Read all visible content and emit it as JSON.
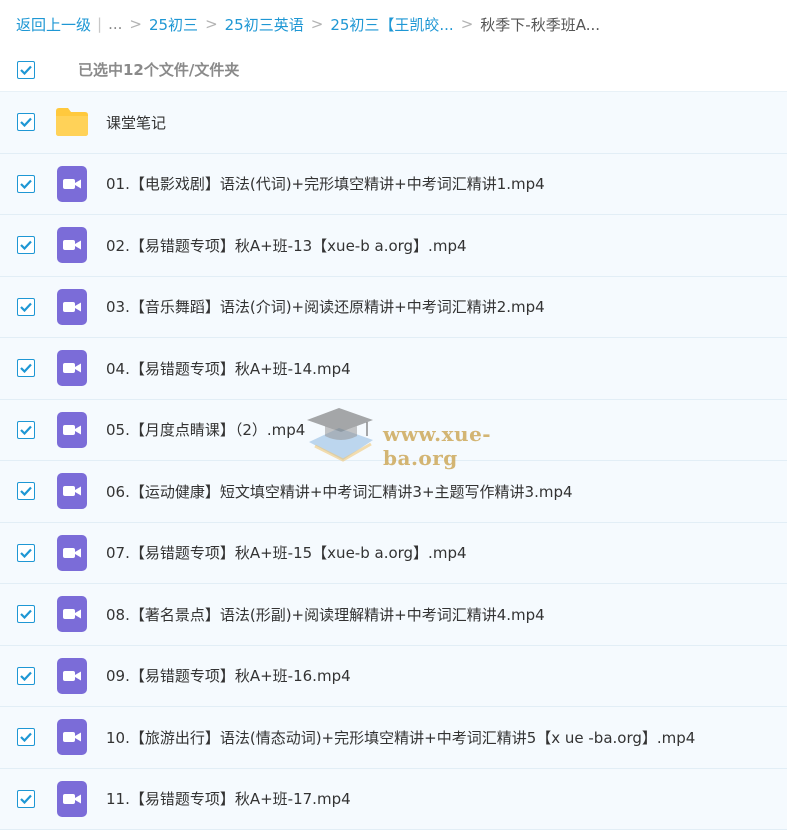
{
  "breadcrumb": {
    "back": "返回上一级",
    "ellipsis": "...",
    "items": [
      "25初三",
      "25初三英语",
      "25初三【王凯皎..."
    ],
    "current": "秋季下-秋季班A..."
  },
  "selection": {
    "label": "已选中12个文件/文件夹"
  },
  "files": [
    {
      "type": "folder",
      "name": "课堂笔记"
    },
    {
      "type": "video",
      "name": "01.【电影戏剧】语法(代词)+完形填空精讲+中考词汇精讲1.mp4"
    },
    {
      "type": "video",
      "name": "02.【易错题专项】秋A+班-13【xue-b a.org】.mp4"
    },
    {
      "type": "video",
      "name": "03.【音乐舞蹈】语法(介词)+阅读还原精讲+中考词汇精讲2.mp4"
    },
    {
      "type": "video",
      "name": "04.【易错题专项】秋A+班-14.mp4"
    },
    {
      "type": "video",
      "name": "05.【月度点睛课】（2）.mp4"
    },
    {
      "type": "video",
      "name": "06.【运动健康】短文填空精讲+中考词汇精讲3+主题写作精讲3.mp4"
    },
    {
      "type": "video",
      "name": "07.【易错题专项】秋A+班-15【xue-b a.org】.mp4"
    },
    {
      "type": "video",
      "name": "08.【著名景点】语法(形副)+阅读理解精讲+中考词汇精讲4.mp4"
    },
    {
      "type": "video",
      "name": "09.【易错题专项】秋A+班-16.mp4"
    },
    {
      "type": "video",
      "name": "10.【旅游出行】语法(情态动词)+完形填空精讲+中考词汇精讲5【x ue -ba.org】.mp4"
    },
    {
      "type": "video",
      "name": "11.【易错题专项】秋A+班-17.mp4"
    }
  ],
  "watermark": {
    "text": "www.xue-ba.org"
  },
  "colors": {
    "accent": "#1e97d4",
    "folder": "#ffc93d",
    "video": "#7b6cd8",
    "row_bg": "#f5fafe"
  }
}
